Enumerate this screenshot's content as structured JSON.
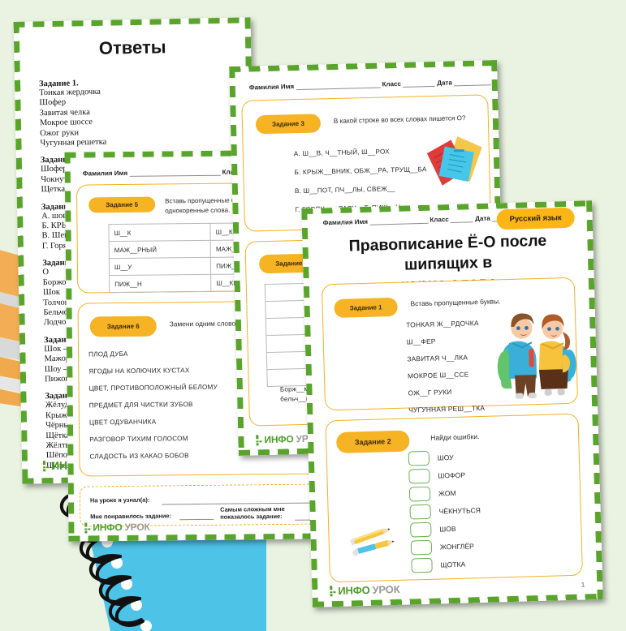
{
  "background_color": "#eaf3e2",
  "brand": {
    "name_bold": "ИНФО",
    "name_light": "УРОК"
  },
  "id_line": {
    "name_label": "Фамилия Имя",
    "class_label": "Класс",
    "date_label": "Дата"
  },
  "answers_card": {
    "title": "Ответы",
    "blocks": [
      {
        "heading": "Задание 1.",
        "items": [
          "Тонкая жердочка",
          "Шофер",
          "Завитая челка",
          "Мокрое шоссе",
          "Ожог руки",
          "Чугунная решетка"
        ]
      },
      {
        "heading": "Задание 2.",
        "items": [
          "Шофер",
          "Чокнуться",
          "Щетка"
        ]
      },
      {
        "heading": "Задание 3.",
        "items": [
          "А. шов, чётный, шорох",
          "Б. КРЫЖОВНИК",
          "В. Шепот",
          "Г. Горячо"
        ]
      },
      {
        "heading": "Задание 4.",
        "items": [
          "О",
          "Боржоми",
          "Шок",
          "Толчок",
          "Бельчонок",
          "Лодчонка"
        ]
      },
      {
        "heading": "Задание 5.",
        "items": [
          "Шок – шок",
          "Мажорный",
          "Шоу – шоу",
          "Пижон – "
        ]
      },
      {
        "heading": "Задание 6.",
        "items": [
          "Жёлудь",
          "Крыжовник",
          "Чёрный",
          "Щётка",
          "Жёлтый",
          "Шёпот",
          "Шоколад"
        ]
      }
    ]
  },
  "card56": {
    "task5": {
      "pill": "Задание 5",
      "prompt_line1": "Вставь пропущенные буквы и",
      "prompt_line2": "однокоренные слова.",
      "rows": [
        [
          "Ш__К",
          "Ш__КИРОВ"
        ],
        [
          "МАЖ__РНЫЙ",
          "МАЖ__Р"
        ],
        [
          "Ш__У",
          "ПИЖ__НСК"
        ],
        [
          "ПИЖ__Н",
          "Ш__КИРОВ"
        ]
      ]
    },
    "task6": {
      "pill": "Задание 6",
      "prompt": "Замени одним словом",
      "items": [
        "ПЛОД ДУБА",
        "ЯГОДЫ НА КОЛЮЧИХ КУСТАХ",
        "ЦВЕТ, ПРОТИВОПОЛОЖНЫЙ  БЕЛОМУ",
        "ПРЕДМЕТ ДЛЯ ЧИСТКИ ЗУБОВ",
        "ЦВЕТ ОДУВАНЧИКА",
        "РАЗГОВОР ТИХИМ ГОЛОСОМ",
        "СЛАДОСТЬ ИЗ КАКАО БОБОВ"
      ]
    },
    "reflection": {
      "line1": "На уроке я узнал(а):",
      "line2": "Мне понравилось задание:",
      "line3a": "Самым сложным мне",
      "line3b": "показалось задание:"
    }
  },
  "card34": {
    "task3": {
      "pill": "Задание 3",
      "prompt": "В какой строке во всех словах пишется О?",
      "options": [
        "А. Ш__В, Ч__ТНЫЙ, Ш__РОХ",
        "Б. КРЫЖ__ВНИК, ОБЖ__РА, ТРУЩ__БА",
        "В. Ш__ПОТ, ПЧ__ЛЫ, СВЕЖ__",
        "Г. ГОРЯЧ__ , РАСЧ__Т, ПИЖ__Н"
      ],
      "illustration": "books-icon"
    },
    "task4": {
      "pill": "Задание 4",
      "row_count": 6,
      "footer_line1": "Борж__ми,",
      "footer_line2": "бельч__нок"
    }
  },
  "front_card": {
    "subject_pill": "Русский язык",
    "title_line1": "Правописание Ё-О после шипящих в",
    "title_line2": "корне слова",
    "task1": {
      "pill": "Задание 1",
      "prompt": "Вставь пропущенные буквы.",
      "items": [
        "ТОНКАЯ Ж__РДОЧКА",
        "Ш__ФЕР",
        "ЗАВИТАЯ Ч__ЛКА",
        "МОКРОЕ Ш__ССЕ",
        "ОЖ__Г РУКИ",
        "ЧУГУННАЯ РЕШ__ТКА"
      ],
      "illustration": "two-pupils-icon"
    },
    "task2": {
      "pill": "Задание 2",
      "prompt": "Найди ошибки.",
      "items": [
        "ШОУ",
        "ШОФОР",
        "ЖОМ",
        "ЧЁКНУТЬСЯ",
        "ШОВ",
        "ЖОНГЛЁР",
        "ЩОТКА"
      ],
      "illustration": "pencils-icon"
    },
    "page_number": "1"
  },
  "colors": {
    "green_dash": "#59a42a",
    "yellow": "#f6b323",
    "card_border": "#f5b021",
    "checkbox_green": "#6ab04a",
    "notebook_blue": "#4ec3e8",
    "folder_orange": "#f0a94c"
  }
}
